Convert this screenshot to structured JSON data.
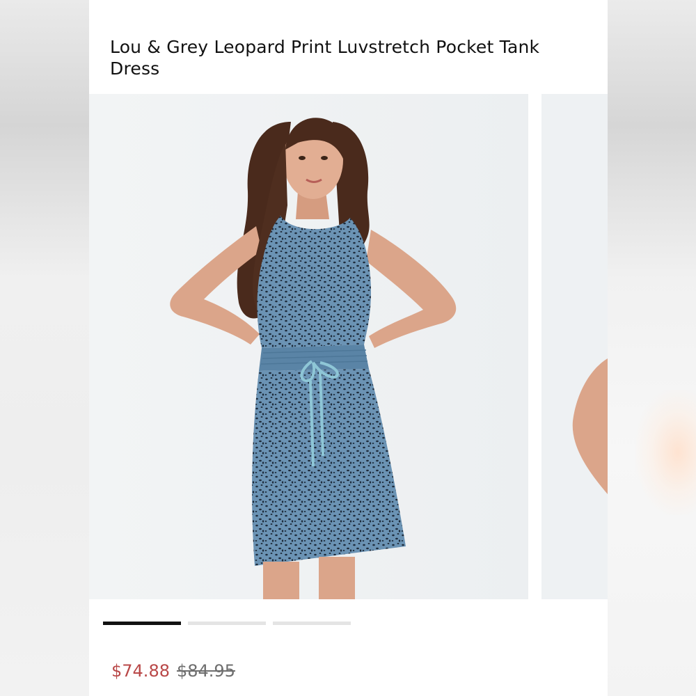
{
  "product": {
    "title": "Lou & Grey Leopard Print Luvstretch Pocket Tank Dress",
    "sale_price": "$74.88",
    "original_price": "$84.95"
  },
  "carousel": {
    "slide_count": 3,
    "active_index": 0
  },
  "colors": {
    "sale_price": "#b94848",
    "indicator_active": "#111111",
    "indicator_inactive": "#e4e4e4",
    "dress": "#5f87a8",
    "drawstring": "#8ec6d6"
  }
}
